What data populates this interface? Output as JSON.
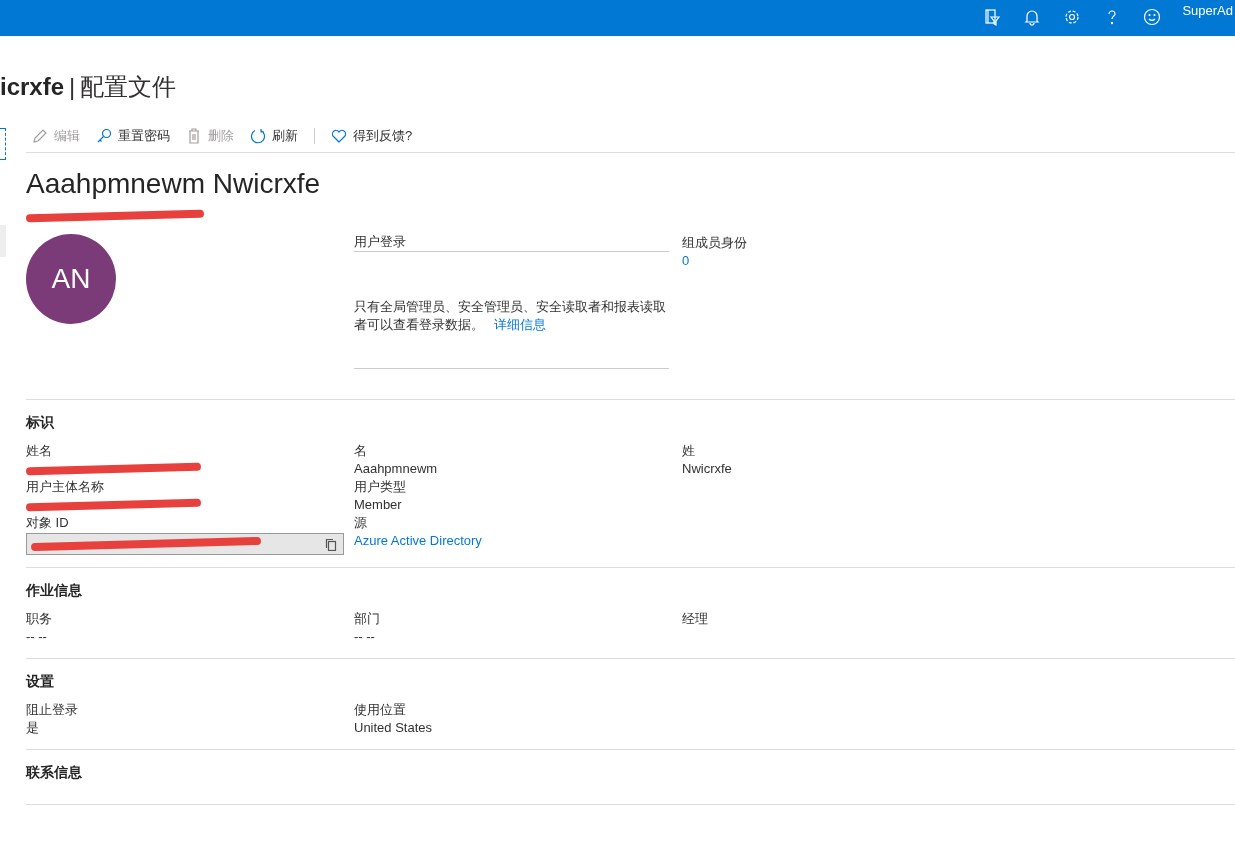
{
  "top_bar": {
    "icons": [
      {
        "kind": "directory-filter"
      },
      {
        "kind": "bell"
      },
      {
        "kind": "gear"
      },
      {
        "kind": "help"
      },
      {
        "kind": "smiley"
      }
    ],
    "user": "SuperAd"
  },
  "header": {
    "title": "icrxfe",
    "separator": "|",
    "subtitle": "配置文件"
  },
  "toolbar": [
    {
      "kind": "edit",
      "label": "编辑",
      "disabled": true
    },
    {
      "kind": "key",
      "label": "重置密码",
      "disabled": false
    },
    {
      "kind": "delete",
      "label": "删除",
      "disabled": true
    },
    {
      "kind": "refresh",
      "label": "刷新",
      "disabled": false
    },
    {
      "kind": "heart",
      "label": "得到反馈?",
      "disabled": false
    }
  ],
  "profile": {
    "name": "Aaahpmnewm Nwicrxfe",
    "avatar": {
      "initials": "AN",
      "color": "#7b3b78"
    },
    "sign_in": {
      "label": "用户登录",
      "message": "只有全局管理员、安全管理员、安全读取者和报表读取者可以查看登录数据。",
      "link": "详细信息"
    },
    "membership": {
      "label": "组成员身份",
      "value": "0"
    }
  },
  "sections": [
    {
      "title": "标识",
      "fields": [
        {
          "label": "姓名",
          "kind": "redacted"
        },
        {
          "label": "名",
          "kind": "text",
          "value": "Aaahpmnewm"
        },
        {
          "label": "姓",
          "kind": "text",
          "value": "Nwicrxfe"
        },
        {
          "label": "用户主体名称",
          "kind": "redacted"
        },
        {
          "label": "用户类型",
          "kind": "text",
          "value": "Member"
        },
        {
          "kind": "empty"
        },
        {
          "label": "对象 ID",
          "kind": "copy"
        },
        {
          "label": "源",
          "kind": "link",
          "value": "Azure Active Directory"
        },
        {
          "kind": "empty"
        }
      ]
    },
    {
      "title": "作业信息",
      "fields": [
        {
          "label": "职务",
          "kind": "text",
          "value": "-- --"
        },
        {
          "label": "部门",
          "kind": "text",
          "value": "-- --"
        },
        {
          "label": "经理",
          "kind": "text"
        }
      ]
    },
    {
      "title": "设置",
      "fields": [
        {
          "label": "阻止登录",
          "kind": "text",
          "value": "是"
        },
        {
          "label": "使用位置",
          "kind": "text",
          "value": "United States"
        }
      ]
    },
    {
      "title": "联系信息"
    }
  ]
}
